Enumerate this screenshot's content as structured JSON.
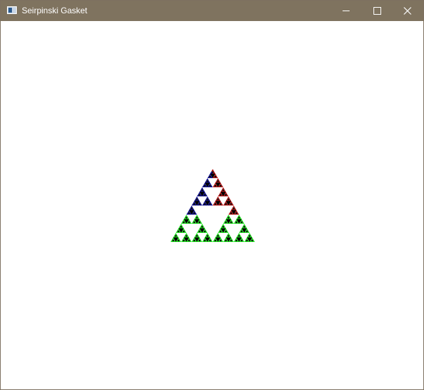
{
  "window": {
    "title": "Seirpinski Gasket",
    "titlebar_color": "#7f735f"
  },
  "controls": {
    "minimize_icon": "minimize-icon",
    "maximize_icon": "maximize-icon",
    "close_icon": "close-icon"
  },
  "canvas": {
    "figure": "sierpinski-gasket",
    "colors": {
      "left_face": "#0a0a8c",
      "right_face": "#b01010",
      "base_face": "#18e018",
      "holes": "#000000",
      "background": "#ffffff"
    }
  }
}
